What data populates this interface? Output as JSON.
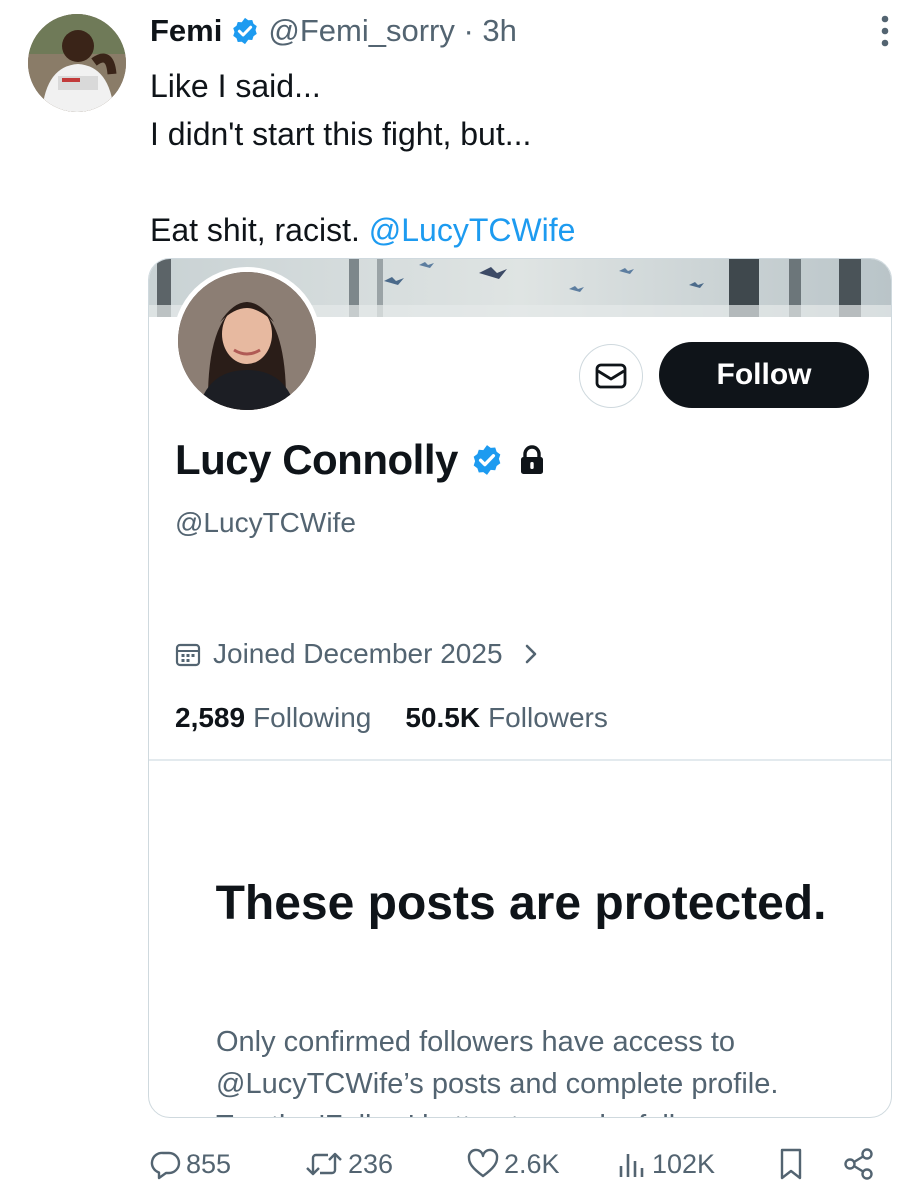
{
  "tweet": {
    "author_name": "Femi",
    "handle": "@Femi_sorry",
    "separator": "·",
    "time": "3h",
    "text_lines": [
      "Like I said...",
      "I didn't start this fight, but...",
      "",
      "Eat shit, racist. "
    ],
    "mention": "@LucyTCWife"
  },
  "profile_card": {
    "name": "Lucy Connolly",
    "handle": "@LucyTCWife",
    "joined": "Joined December 2025",
    "following_count": "2,589",
    "following_label": "Following",
    "followers_count": "50.5K",
    "followers_label": "Followers",
    "follow_label": "Follow",
    "protected_title": "These posts are protected.",
    "protected_body": [
      "Only confirmed followers have access to",
      "@LucyTCWife’s posts and complete profile.",
      "Tap the 'Follow' button to send a follow"
    ]
  },
  "actions": {
    "replies": "855",
    "reposts": "236",
    "likes": "2.6K",
    "views": "102K"
  },
  "colors": {
    "accent": "#1d9bf0",
    "text": "#0f1419",
    "muted": "#536471",
    "border": "#cfd9de"
  },
  "icons": [
    "verified-badge-icon",
    "more-icon",
    "mail-icon",
    "lock-icon",
    "calendar-icon",
    "chevron-right-icon",
    "reply-icon",
    "repost-icon",
    "like-icon",
    "views-icon",
    "bookmark-icon",
    "share-icon"
  ]
}
